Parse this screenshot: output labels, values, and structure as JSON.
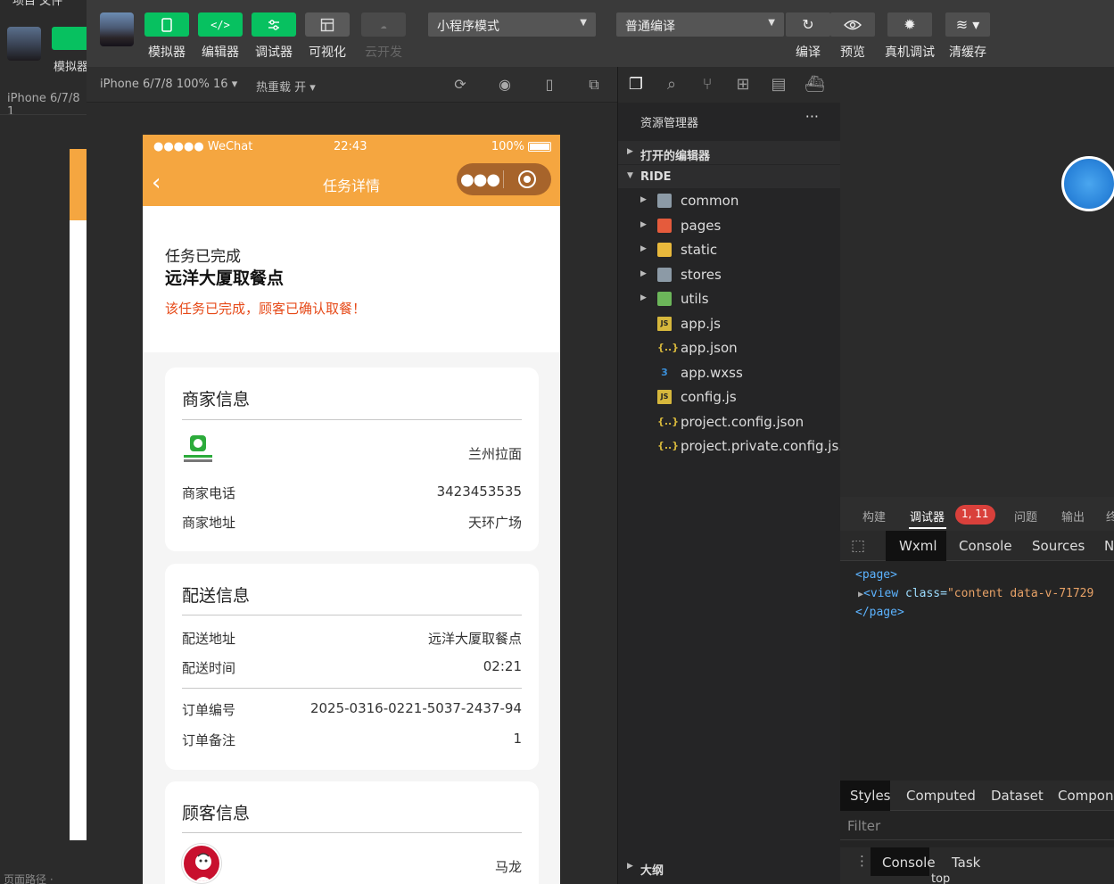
{
  "background_window": {
    "menu_text": "项目 文件",
    "simulator_label": "模拟器",
    "device_label": "iPhone 6/7/8 1",
    "status_text": "页面路径 ·"
  },
  "toolbar": {
    "simulator": "模拟器",
    "editor": "编辑器",
    "debugger": "调试器",
    "visualize": "可视化",
    "cloud": "云开发",
    "mode_select": "小程序模式",
    "compile_select": "普通编译",
    "compile": "编译",
    "preview": "预览",
    "real_debug": "真机调试",
    "clear_cache": "清缓存"
  },
  "simulator_bar": {
    "device": "iPhone 6/7/8 100% 16 ▾",
    "hot_reload": "热重载 开 ▾"
  },
  "phone": {
    "status": {
      "carrier": "●●●●● WeChat",
      "time": "22:43",
      "battery": "100%"
    },
    "nav_title": "任务详情",
    "task": {
      "status": "任务已完成",
      "place": "远洋大厦取餐点",
      "note": "该任务已完成，顾客已确认取餐！"
    },
    "merchant": {
      "title": "商家信息",
      "name": "兰州拉面",
      "phone_label": "商家电话",
      "phone": "3423453535",
      "address_label": "商家地址",
      "address": "天环广场"
    },
    "delivery": {
      "title": "配送信息",
      "address_label": "配送地址",
      "address": "远洋大厦取餐点",
      "time_label": "配送时间",
      "time": "02:21",
      "order_label": "订单编号",
      "order": "2025-0316-0221-5037-2437-94",
      "remark_label": "订单备注",
      "remark": "1"
    },
    "customer": {
      "title": "顾客信息",
      "name": "马龙"
    }
  },
  "explorer": {
    "title": "资源管理器",
    "more": "···",
    "open_editors": "打开的编辑器",
    "project": "RIDE",
    "items": [
      {
        "name": "common",
        "type": "folder"
      },
      {
        "name": "pages",
        "type": "folder"
      },
      {
        "name": "static",
        "type": "folder"
      },
      {
        "name": "stores",
        "type": "folder"
      },
      {
        "name": "utils",
        "type": "folder"
      },
      {
        "name": "app.js",
        "type": "js"
      },
      {
        "name": "app.json",
        "type": "json"
      },
      {
        "name": "app.wxss",
        "type": "css"
      },
      {
        "name": "config.js",
        "type": "js"
      },
      {
        "name": "project.config.json",
        "type": "json"
      },
      {
        "name": "project.private.config.js...",
        "type": "json"
      }
    ],
    "outline": "大纲"
  },
  "devtools": {
    "tabs1": [
      "构建",
      "调试器",
      "问题",
      "输出",
      "终"
    ],
    "badge": "1, 11",
    "tabs2": [
      "Wxml",
      "Console",
      "Sources",
      "N"
    ],
    "code": {
      "line1": "<page>",
      "line2_tag": "<view",
      "line2_attr": " class=",
      "line2_val": "\"content data-v-71729",
      "line3": "</page>"
    },
    "tabs3": [
      "Styles",
      "Computed",
      "Dataset",
      "Compone"
    ],
    "filter": "Filter",
    "tabs4": [
      "Console",
      "Task"
    ],
    "bottom": "top"
  },
  "colors": {
    "accent_green": "#07c160",
    "nav_orange": "#f5a640",
    "warning_red": "#e64a19",
    "badge_red": "#d9403b"
  }
}
